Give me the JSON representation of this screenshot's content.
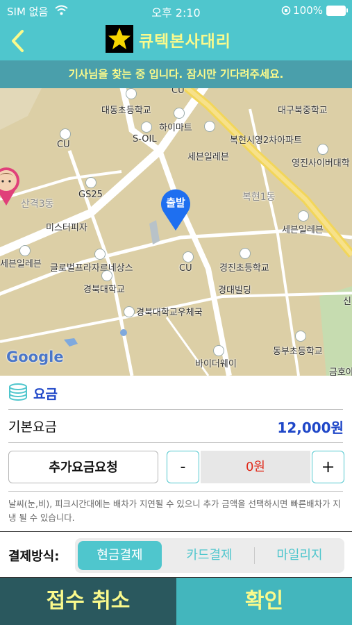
{
  "status_bar": {
    "carrier": "SIM 없음",
    "time": "오후 2:10",
    "battery": "100%"
  },
  "header": {
    "title": "큐텍본사대리",
    "back_icon": "chevron-left-icon",
    "logo_icon": "star-icon"
  },
  "banner": {
    "text": "기사님을 찾는 중 입니다.  잠시만 기다려주세요."
  },
  "map": {
    "pin_label": "출발",
    "attribution": "Google",
    "labels": {
      "cu_top": "CU",
      "daedong_school": "대동초등학교",
      "daegu_bukjung": "대구북중학교",
      "hi_mart": "하이마트",
      "s_oil": "S-OIL",
      "bokhyeon_apt": "복현시영2차아파트",
      "cu_left": "CU",
      "seven_eleven_1": "세븐일레븐",
      "yeongjin_cyber": "영진사이버대학",
      "gs25": "GS25",
      "sangyeok3": "산격3동",
      "bokhyeon1": "복현1동",
      "mister_pizza": "미스터피자",
      "seven_eleven_2": "세븐일레븐",
      "seven_eleven_3": "세븐일레븐",
      "global_plaza": "글로벌프라자르네상스",
      "cu_mid": "CU",
      "gyeongjin_school": "경진초등학교",
      "knu": "경북대학교",
      "gyeongdae_bldg": "경대빌딩",
      "knu_post": "경북대학교우체국",
      "dongbu_middle": "동부초등학교",
      "buy_the_way": "바이더웨이",
      "geumho": "금호아",
      "sin": "신"
    }
  },
  "fare": {
    "section_title": "요금",
    "section_icon": "coins-stack-icon",
    "base_label": "기본요금",
    "base_value": "12,000원",
    "extra_button": "추가요금요청",
    "minus": "-",
    "extra_amount": "0원",
    "plus": "+",
    "notice": "날씨(눈,비), 피크시간대에는 배차가 지연될 수 있으니 추가 금액을 선택하시면 빠른배차가 지냉 될 수 있습니다."
  },
  "payment": {
    "label": "결제방식:",
    "options": [
      "현금결제",
      "카드결제",
      "마일리지"
    ],
    "selected": "현금결제"
  },
  "actions": {
    "cancel": "접수 취소",
    "confirm": "확인"
  },
  "colors": {
    "teal": "#4fc6cd",
    "dark_teal": "#2a585e",
    "yellow": "#fafa8c",
    "blue": "#1f47c8",
    "red": "#e02a1a"
  }
}
